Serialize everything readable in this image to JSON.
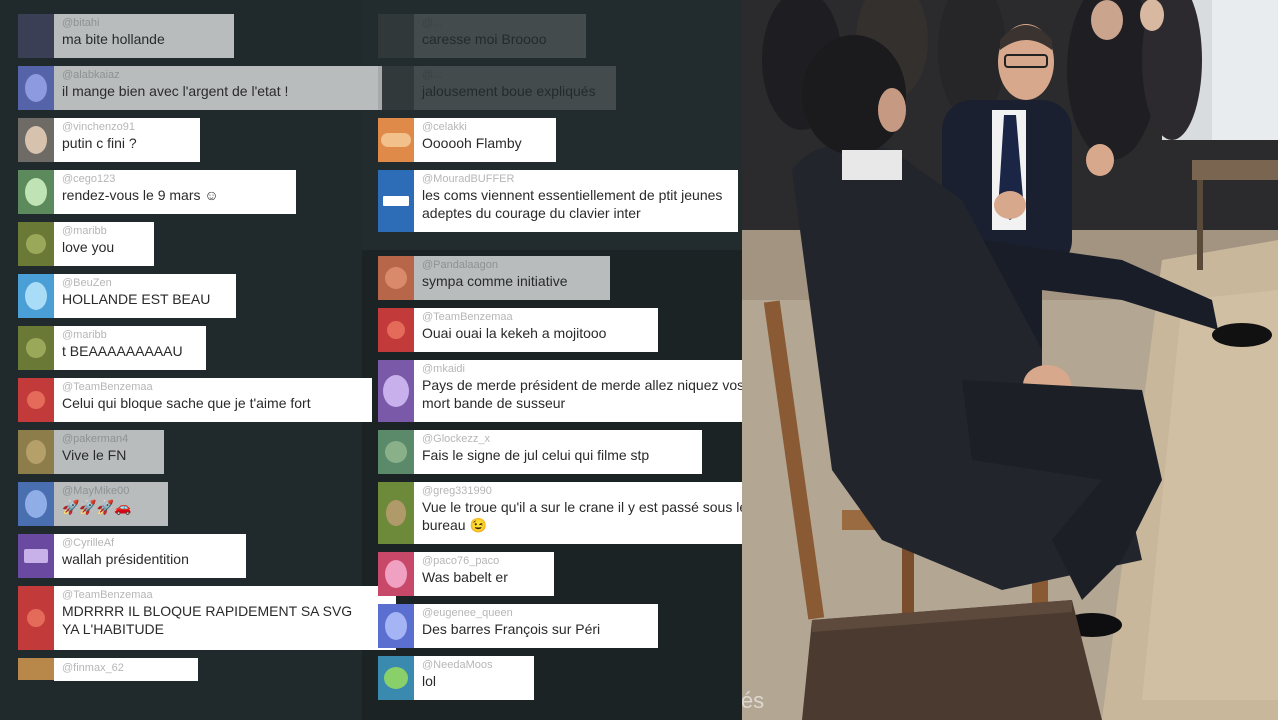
{
  "chat": {
    "column_left": [
      {
        "user": "@bitahi",
        "text": "ma bite hollande",
        "style": "gray",
        "avatar_color": "#3a3f56"
      },
      {
        "user": "@alabkaiaz",
        "text": "il mange bien avec l'argent de l'etat !",
        "style": "gray",
        "avatar_color": "#6d78c8"
      },
      {
        "user": "@vinchenzo91",
        "text": "putin c fini ?",
        "style": "white",
        "avatar_color": "#d7c2ad"
      },
      {
        "user": "@cego123",
        "text": "rendez-vous le 9 mars ☺",
        "style": "white",
        "avatar_color": "#bfe3b4"
      },
      {
        "user": "@maribb",
        "text": "love you",
        "style": "white",
        "avatar_color": "#6a7a36"
      },
      {
        "user": "@BeuZen",
        "text": "HOLLANDE EST BEAU",
        "style": "white",
        "avatar_color": "#7ac4ea"
      },
      {
        "user": "@maribb",
        "text": "t BEAAAAAAAAAU",
        "style": "white",
        "avatar_color": "#6a7a36"
      },
      {
        "user": "@TeamBenzemaa",
        "text": "Celui qui bloque sache que je t'aime fort",
        "style": "white",
        "avatar_color": "#c23a3a"
      },
      {
        "user": "@pakerman4",
        "text": "Vive le FN",
        "style": "gray",
        "avatar_color": "#8d7d4a"
      },
      {
        "user": "@MayMike00",
        "text": "🚀🚀🚀🚗",
        "style": "gray",
        "avatar_color": "#6a8fd0"
      },
      {
        "user": "@CyrilleAf",
        "text": "wallah présidentition",
        "style": "white",
        "avatar_color": "#8a62b8"
      },
      {
        "user": "@TeamBenzemaa",
        "text": "MDRRRR IL BLOQUE RAPIDEMENT SA SVG\nYA L'HABITUDE",
        "style": "white",
        "avatar_color": "#c23a3a"
      },
      {
        "user": "@finmax_62",
        "text": "",
        "style": "white",
        "avatar_color": "#b8874a"
      }
    ],
    "column_right": [
      {
        "user": "@...",
        "text": "caresse moi Broooo",
        "style": "faded",
        "avatar_color": "#666666"
      },
      {
        "user": "@...",
        "text": "jalousement boue expliqués",
        "style": "faded",
        "avatar_color": "#6a6a6a"
      },
      {
        "user": "@celakki",
        "text": "Oooooh Flamby",
        "style": "white",
        "avatar_color": "#e8a068"
      },
      {
        "user": "@MouradBUFFER",
        "text": "les coms viennent essentiellement de ptit jeunes adeptes du courage du clavier inter",
        "style": "white",
        "avatar_color": "#2d6db8"
      },
      {
        "user": "@Pandalaagon",
        "text": "sympa comme initiative",
        "style": "gray",
        "avatar_color": "#b8664a"
      },
      {
        "user": "@TeamBenzemaa",
        "text": "Ouai ouai la kekeh a mojitooo",
        "style": "white",
        "avatar_color": "#c23a3a"
      },
      {
        "user": "@mkaidi",
        "text": "Pays de merde président de merde allez niquez vos mort bande de susseur",
        "style": "white",
        "avatar_color": "#9a78c8"
      },
      {
        "user": "@Glockezz_x",
        "text": "Fais le signe de jul celui qui filme stp",
        "style": "white",
        "avatar_color": "#5b8a6a"
      },
      {
        "user": "@greg331990",
        "text": "Vue le troue qu'il a sur le crane il y est passé sous le bureau 😉",
        "style": "white",
        "avatar_color": "#6d8a3a"
      },
      {
        "user": "@paco76_paco",
        "text": "Was babelt er",
        "style": "white",
        "avatar_color": "#d06a86"
      },
      {
        "user": "@eugenee_queen",
        "text": "Des barres François sur Péri",
        "style": "white",
        "avatar_color": "#7a8fe0"
      },
      {
        "user": "@NeedaMoos",
        "text": "lol",
        "style": "white",
        "avatar_color": "#4aa0c0"
      }
    ]
  },
  "video": {
    "watermark": "iés"
  },
  "colors": {
    "chat_bg": "#1e2629",
    "bubble_white": "#ffffff",
    "bubble_gray": "#b9bcbd"
  }
}
